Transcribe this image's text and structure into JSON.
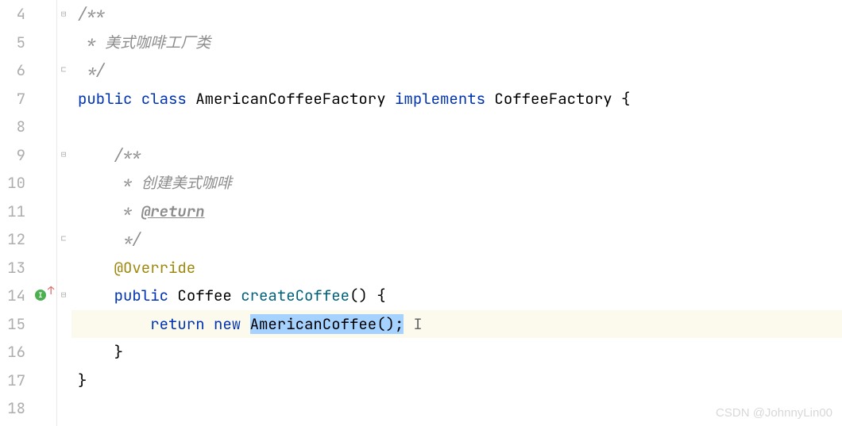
{
  "gutter": {
    "lines": [
      "4",
      "5",
      "6",
      "7",
      "8",
      "9",
      "10",
      "11",
      "12",
      "13",
      "14",
      "15",
      "16",
      "17",
      "18"
    ]
  },
  "markers": {
    "override_line": 14
  },
  "code": {
    "line4": {
      "c1": "/**"
    },
    "line5": {
      "c1": " * 美式咖啡工厂类"
    },
    "line6": {
      "c1": " */"
    },
    "line7": {
      "kw1": "public class ",
      "cls": "AmericanCoffeeFactory ",
      "kw2": "implements ",
      "cls2": "CoffeeFactory ",
      "br": "{"
    },
    "line8": "",
    "line9": {
      "c1": "/**"
    },
    "line10": {
      "c1": " * 创建美式咖啡"
    },
    "line11": {
      "c1": " * ",
      "tag": "@return"
    },
    "line12": {
      "c1": " */"
    },
    "line13": {
      "ann": "@Override"
    },
    "line14": {
      "kw1": "public ",
      "type": "Coffee ",
      "method": "createCoffee",
      "rest": "() {"
    },
    "line15": {
      "kw1": "return new ",
      "sel": "AmericanCoffee();"
    },
    "line16": {
      "br": "}"
    },
    "line17": {
      "br": "}"
    }
  },
  "watermark": "CSDN @JohnnyLin00"
}
